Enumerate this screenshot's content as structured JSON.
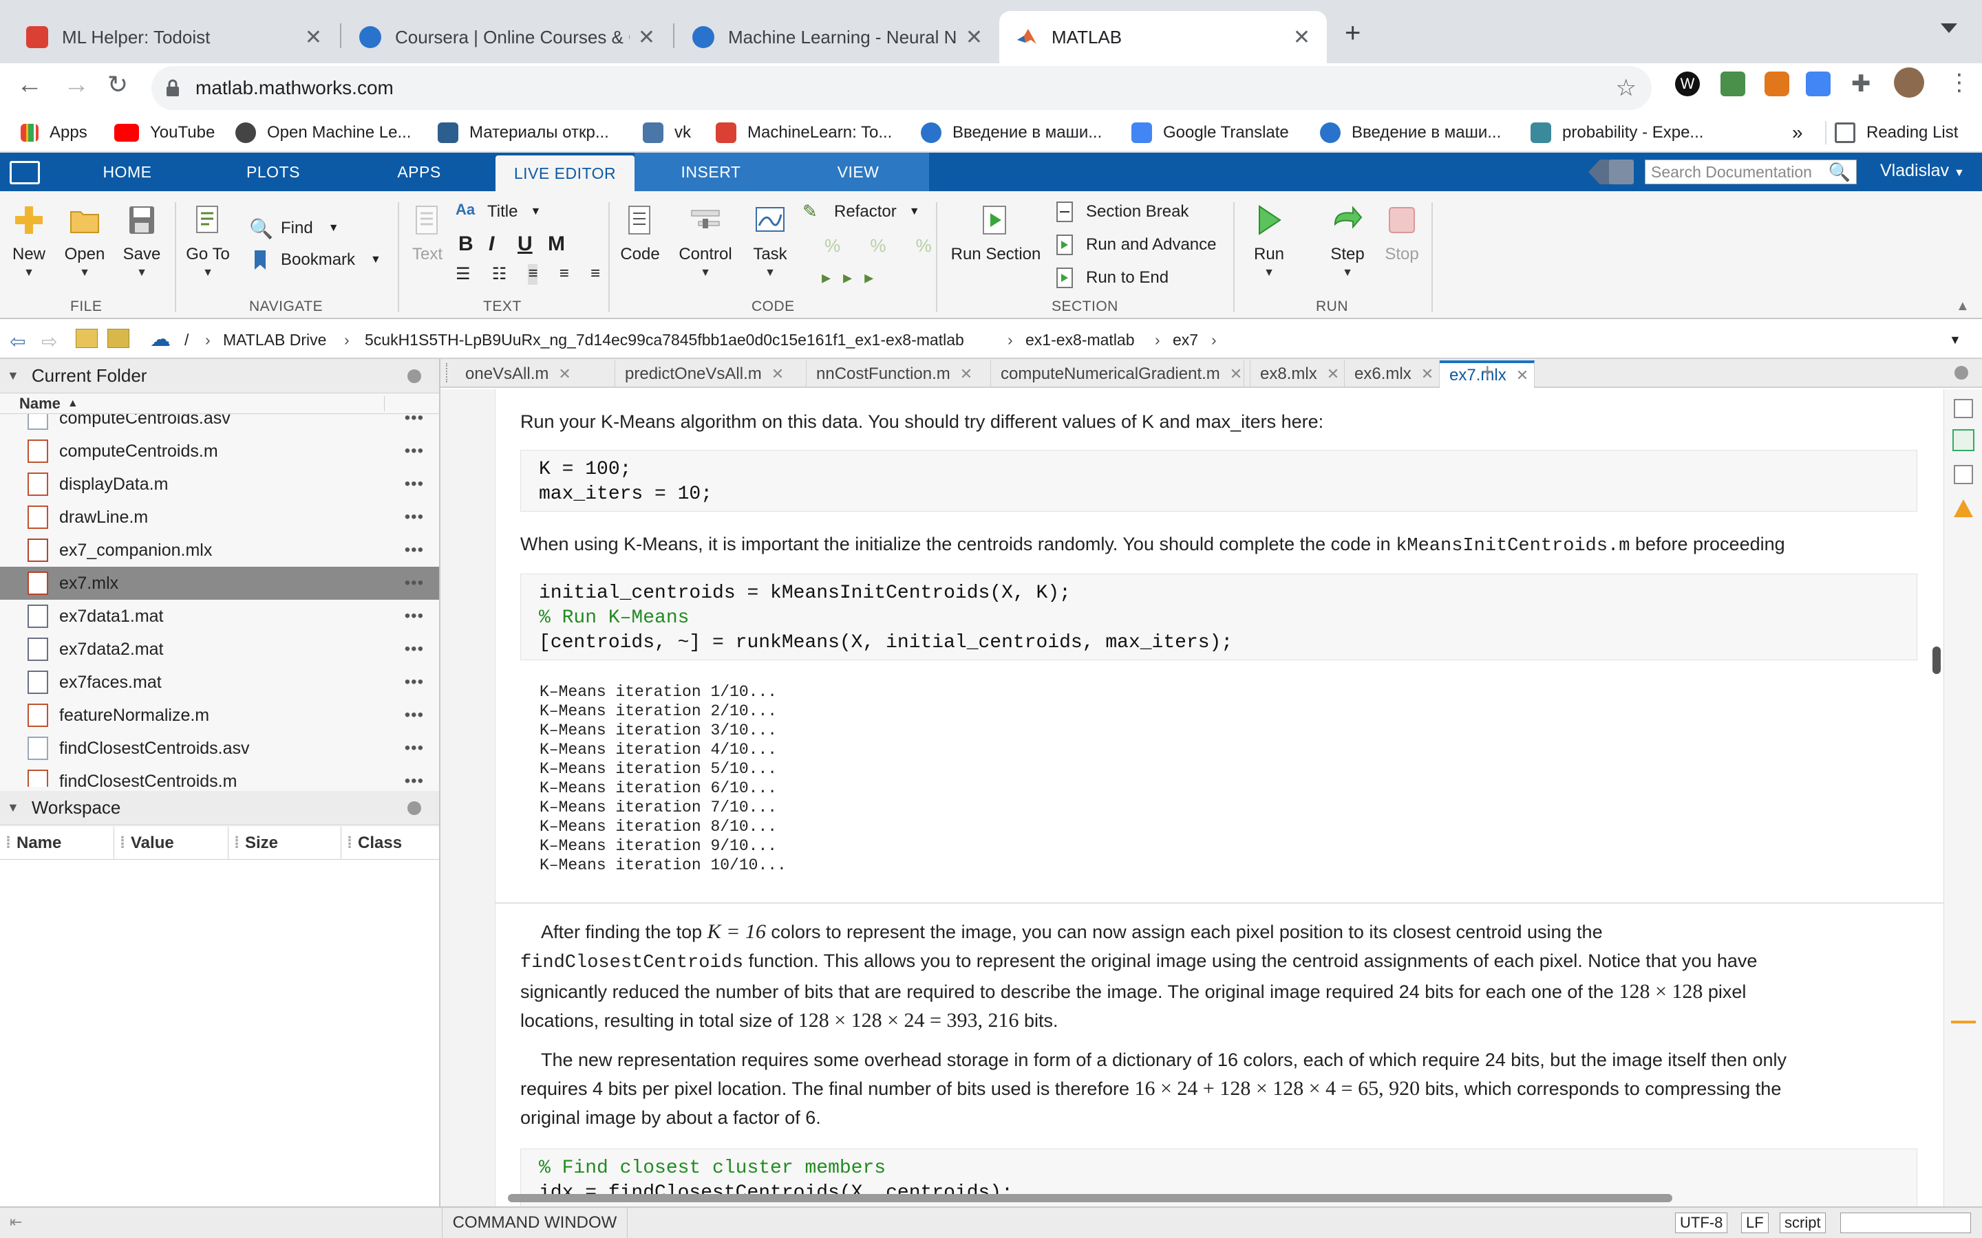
{
  "browser": {
    "tabs": [
      {
        "title": "ML Helper: Todoist",
        "color": "#db4035",
        "active": false
      },
      {
        "title": "Coursera | Online Courses & Cr",
        "color": "#2a73cc",
        "active": false
      },
      {
        "title": "Machine Learning - Neural Net",
        "color": "#2a73cc",
        "active": false
      },
      {
        "title": "MATLAB",
        "color": "#e16737",
        "active": true
      }
    ],
    "new_tab": "+",
    "url": "matlab.mathworks.com",
    "bookmarks": [
      {
        "label": "Apps"
      },
      {
        "label": "YouTube"
      },
      {
        "label": "Open Machine Le..."
      },
      {
        "label": "Материалы откр..."
      },
      {
        "label": "vk"
      },
      {
        "label": "MachineLearn: To..."
      },
      {
        "label": "Введение в маши..."
      },
      {
        "label": "Google Translate"
      },
      {
        "label": "Введение в маши..."
      },
      {
        "label": "probability - Expe..."
      }
    ],
    "more": "»",
    "reading_list": "Reading List"
  },
  "matlab": {
    "tabs": [
      "HOME",
      "PLOTS",
      "APPS",
      "LIVE EDITOR",
      "INSERT",
      "VIEW"
    ],
    "active_tab": "LIVE EDITOR",
    "search_placeholder": "Search Documentation",
    "user": "Vladislav",
    "ribbon": {
      "file": {
        "label": "FILE",
        "new": "New",
        "open": "Open",
        "save": "Save"
      },
      "navigate": {
        "label": "NAVIGATE",
        "goto": "Go To",
        "find": "Find",
        "bookmark": "Bookmark"
      },
      "text": {
        "label": "TEXT",
        "text_btn": "Text",
        "style": "Title",
        "bold": "B",
        "italic": "I",
        "underline": "U",
        "mono": "M"
      },
      "code": {
        "label": "CODE",
        "code": "Code",
        "control": "Control",
        "task": "Task",
        "refactor": "Refactor"
      },
      "section": {
        "label": "SECTION",
        "run_section": "Run Section",
        "section_break": "Section Break",
        "run_advance": "Run and Advance",
        "run_end": "Run to End"
      },
      "run": {
        "label": "RUN",
        "run": "Run",
        "step": "Step",
        "stop": "Stop"
      }
    },
    "breadcrumbs": [
      "/",
      "MATLAB Drive",
      "5cukH1S5TH-LpB9UuRx_ng_7d14ec99ca7845fbb1ae0d0c15e161f1_ex1-ex8-matlab",
      "ex1-ex8-matlab",
      "ex7"
    ],
    "current_folder": {
      "title": "Current Folder",
      "column": "Name",
      "files": [
        {
          "name": "computeCentroids.asv",
          "type": "asv"
        },
        {
          "name": "computeCentroids.m",
          "type": "m"
        },
        {
          "name": "displayData.m",
          "type": "m"
        },
        {
          "name": "drawLine.m",
          "type": "m"
        },
        {
          "name": "ex7_companion.mlx",
          "type": "mlx"
        },
        {
          "name": "ex7.mlx",
          "type": "mlx",
          "selected": true
        },
        {
          "name": "ex7data1.mat",
          "type": "mat"
        },
        {
          "name": "ex7data2.mat",
          "type": "mat"
        },
        {
          "name": "ex7faces.mat",
          "type": "mat"
        },
        {
          "name": "featureNormalize.m",
          "type": "m"
        },
        {
          "name": "findClosestCentroids.asv",
          "type": "asv"
        },
        {
          "name": "findClosestCentroids.m",
          "type": "m"
        }
      ],
      "dots": "•••"
    },
    "workspace": {
      "title": "Workspace",
      "columns": [
        "Name",
        "Value",
        "Size",
        "Class"
      ]
    },
    "editor_tabs": [
      {
        "name": "oneVsAll.m"
      },
      {
        "name": "predictOneVsAll.m"
      },
      {
        "name": "nnCostFunction.m"
      },
      {
        "name": "computeNumericalGradient.m"
      },
      {
        "name": "ex8.mlx"
      },
      {
        "name": "ex6.mlx"
      },
      {
        "name": "ex7.mlx",
        "active": true
      }
    ],
    "editor": {
      "p1": "Run your K-Means algorithm on this data. You should try different values of K and max_iters here:",
      "code1": [
        "K = 100;",
        "max_iters = 10;"
      ],
      "p2a": "When using K-Means, it is important the initialize the centroids randomly. You should complete the code in ",
      "p2code": "kMeansInitCentroids.m",
      "p2b": " before proceeding",
      "code2": [
        "initial_centroids = kMeansInitCentroids(X, K);",
        "% Run K–Means",
        "[centroids, ~] = runkMeans(X, initial_centroids, max_iters);"
      ],
      "output": [
        "K–Means iteration 1/10...",
        "K–Means iteration 2/10...",
        "K–Means iteration 3/10...",
        "K–Means iteration 4/10...",
        "K–Means iteration 5/10...",
        "K–Means iteration 6/10...",
        "K–Means iteration 7/10...",
        "K–Means iteration 8/10...",
        "K–Means iteration 9/10...",
        "K–Means iteration 10/10..."
      ],
      "p3_1a": "After finding the top ",
      "p3_1m": "K = 16",
      "p3_1b": " colors to represent the image, you can now assign each pixel position to its closest centroid using the",
      "p3_2code": "findClosestCentroids",
      "p3_2b": " function. This allows you to represent the original image using the centroid assignments of each pixel. Notice that you have",
      "p3_3a": "signicantly reduced the number of bits that are required to describe the image. The original image required 24 bits for each one of the ",
      "p3_3m": "128 × 128",
      "p3_3b": " pixel",
      "p3_4a": "locations, resulting in total size of ",
      "p3_4m": "128 × 128 × 24 = 393, 216",
      "p3_4b": " bits.",
      "p4_1": "The new representation requires some overhead storage in form of a dictionary of 16 colors, each of which require 24 bits, but the image itself then only",
      "p4_2a": "requires 4 bits per pixel location. The final number of bits used is therefore ",
      "p4_2m": "16 × 24 + 128 × 128 × 4 = 65, 920",
      "p4_2b": " bits, which corresponds to compressing the",
      "p4_3": "original image by about a factor of 6.",
      "code3": [
        "% Find closest cluster members",
        "idx = findClosestCentroids(X, centroids);"
      ]
    },
    "status": {
      "command_window": "COMMAND WINDOW",
      "encoding": "UTF-8",
      "eol": "LF",
      "mode": "script"
    }
  }
}
